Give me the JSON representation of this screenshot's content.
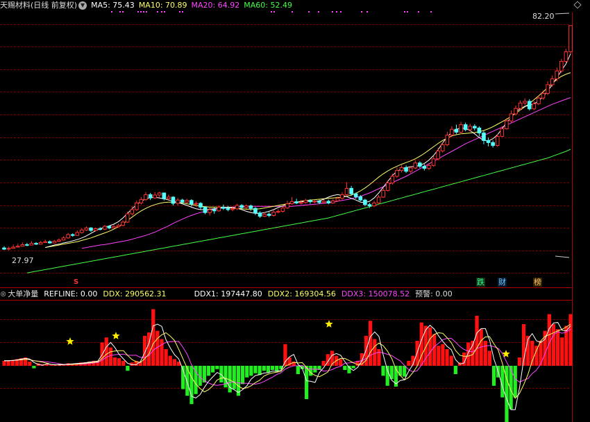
{
  "header": {
    "title": "天赐材料(日线 前复权)",
    "dropdown_icon": "chevron-down-icon",
    "ma5": {
      "label": "MA5: 75.43",
      "color": "#ffffff"
    },
    "ma10": {
      "label": "MA10: 70.89",
      "color": "#ffff66"
    },
    "ma20": {
      "label": "MA20: 64.92",
      "color": "#ff44ff"
    },
    "ma60": {
      "label": "MA60: 52.49",
      "color": "#44ff44"
    }
  },
  "price_labels": {
    "high": "82.20",
    "low": "27.97"
  },
  "signals": {
    "s_marker": "S",
    "badges": [
      {
        "text": "跌",
        "color": "#33ff99",
        "bg": "#113311"
      },
      {
        "text": "财",
        "color": "#66ccff",
        "bg": "#0a1a33"
      },
      {
        "text": "榜",
        "color": "#ffcc66",
        "bg": "#332200"
      }
    ]
  },
  "indicator": {
    "name": "大单净量",
    "refline": {
      "label": "REFLINE: 0.00",
      "color": "#ffffff"
    },
    "ddx": {
      "label": "DDX: 290562.31",
      "color": "#ffff66"
    },
    "ddx1": {
      "label": "DDX1: 197447.80",
      "color": "#ffffff"
    },
    "ddx2": {
      "label": "DDX2: 169304.56",
      "color": "#ffff66"
    },
    "ddx3": {
      "label": "DDX3: 150078.52",
      "color": "#ff44ff"
    },
    "alert": {
      "label": "预警: 0.00",
      "color": "#dddddd"
    }
  },
  "colors": {
    "up": "#ff3333",
    "down": "#54ffff",
    "bar_pos": "#ff1111",
    "bar_neg": "#22ee22",
    "star": "#ffee00",
    "ma5": "#ffffff",
    "ma10": "#ffff66",
    "ma20": "#ff44ff",
    "ma60": "#44ff44"
  },
  "chart_data": {
    "type": "candlestick",
    "ylim": [
      27.97,
      82.2
    ],
    "candles": [
      [
        28.8,
        28.5,
        29.2,
        28.3
      ],
      [
        28.5,
        28.7,
        29.1,
        28.2
      ],
      [
        28.7,
        29.0,
        29.6,
        28.6
      ],
      [
        29.0,
        29.2,
        29.8,
        28.9
      ],
      [
        29.2,
        29.6,
        30.1,
        29.1
      ],
      [
        29.6,
        29.5,
        30.0,
        29.2
      ],
      [
        29.5,
        29.9,
        30.4,
        29.4
      ],
      [
        29.9,
        29.7,
        30.2,
        29.5
      ],
      [
        29.7,
        30.1,
        30.5,
        29.6
      ],
      [
        30.1,
        30.3,
        30.8,
        30.0
      ],
      [
        30.3,
        30.0,
        30.6,
        29.8
      ],
      [
        30.0,
        30.4,
        30.7,
        29.9
      ],
      [
        30.4,
        30.7,
        31.1,
        30.2
      ],
      [
        30.7,
        31.2,
        31.6,
        30.6
      ],
      [
        31.2,
        32.0,
        32.4,
        31.0
      ],
      [
        32.0,
        31.8,
        32.3,
        31.5
      ],
      [
        31.8,
        32.5,
        33.0,
        31.7
      ],
      [
        32.5,
        33.1,
        33.5,
        32.2
      ],
      [
        33.1,
        33.6,
        34.0,
        32.9
      ],
      [
        33.6,
        33.0,
        33.8,
        32.6
      ],
      [
        33.0,
        33.4,
        33.7,
        32.7
      ],
      [
        33.4,
        33.3,
        33.8,
        33.0
      ],
      [
        33.3,
        34.0,
        34.3,
        33.1
      ],
      [
        34.0,
        33.6,
        34.2,
        33.3
      ],
      [
        33.6,
        33.9,
        34.4,
        33.5
      ],
      [
        33.9,
        34.2,
        34.6,
        33.7
      ],
      [
        34.2,
        35.0,
        35.4,
        34.0
      ],
      [
        35.0,
        37.0,
        37.5,
        34.8
      ],
      [
        37.0,
        38.0,
        38.8,
        36.6
      ],
      [
        38.0,
        39.6,
        40.2,
        37.7
      ],
      [
        39.6,
        40.4,
        41.0,
        39.2
      ],
      [
        40.4,
        41.6,
        42.2,
        40.1
      ],
      [
        41.6,
        40.8,
        42.0,
        40.3
      ],
      [
        40.8,
        41.5,
        42.2,
        40.6
      ],
      [
        41.5,
        42.0,
        42.3,
        40.9
      ],
      [
        42.0,
        40.6,
        42.1,
        40.2
      ],
      [
        40.6,
        41.0,
        41.6,
        40.3
      ],
      [
        41.0,
        39.5,
        41.2,
        39.0
      ],
      [
        39.5,
        40.3,
        40.8,
        39.0
      ],
      [
        40.3,
        39.8,
        40.6,
        39.4
      ],
      [
        39.8,
        40.2,
        40.6,
        39.5
      ],
      [
        40.2,
        39.3,
        40.5,
        38.8
      ],
      [
        39.3,
        39.5,
        40.0,
        38.7
      ],
      [
        39.5,
        38.6,
        39.8,
        38.1
      ],
      [
        38.6,
        37.3,
        38.8,
        36.9
      ],
      [
        37.3,
        38.0,
        38.6,
        36.6
      ],
      [
        38.0,
        37.7,
        38.5,
        37.0
      ],
      [
        37.7,
        38.6,
        39.0,
        37.5
      ],
      [
        38.6,
        38.3,
        39.2,
        37.9
      ],
      [
        38.3,
        38.0,
        38.9,
        37.6
      ],
      [
        38.0,
        38.2,
        38.8,
        37.6
      ],
      [
        38.2,
        39.0,
        39.4,
        37.9
      ],
      [
        39.0,
        38.5,
        39.3,
        38.1
      ],
      [
        38.5,
        38.9,
        39.3,
        38.2
      ],
      [
        38.9,
        38.3,
        39.2,
        37.7
      ],
      [
        38.3,
        37.2,
        38.6,
        36.7
      ],
      [
        37.2,
        36.4,
        37.6,
        36.0
      ],
      [
        36.4,
        36.9,
        37.4,
        36.2
      ],
      [
        36.9,
        36.6,
        37.4,
        36.2
      ],
      [
        36.6,
        37.4,
        37.8,
        36.3
      ],
      [
        37.4,
        37.6,
        38.1,
        37.1
      ],
      [
        37.6,
        38.4,
        38.9,
        37.3
      ],
      [
        38.4,
        39.4,
        40.1,
        38.2
      ],
      [
        39.4,
        39.9,
        41.0,
        39.2
      ],
      [
        39.9,
        39.6,
        40.6,
        39.3
      ],
      [
        39.6,
        39.7,
        40.3,
        39.2
      ],
      [
        39.7,
        40.2,
        40.6,
        39.4
      ],
      [
        40.2,
        39.9,
        40.5,
        39.4
      ],
      [
        39.9,
        40.0,
        40.4,
        39.5
      ],
      [
        40.0,
        39.7,
        40.4,
        39.3
      ],
      [
        39.7,
        40.0,
        40.4,
        39.4
      ],
      [
        40.0,
        39.6,
        40.4,
        39.3
      ],
      [
        39.6,
        40.1,
        40.5,
        39.4
      ],
      [
        40.1,
        40.7,
        41.1,
        39.9
      ],
      [
        40.7,
        41.6,
        42.2,
        40.4
      ],
      [
        41.6,
        43.1,
        44.6,
        41.2
      ],
      [
        43.1,
        41.8,
        43.7,
        41.3
      ],
      [
        41.8,
        41.1,
        42.1,
        40.6
      ],
      [
        41.1,
        40.3,
        41.5,
        40.0
      ],
      [
        40.3,
        39.2,
        40.6,
        38.8
      ],
      [
        39.2,
        38.9,
        39.6,
        38.4
      ],
      [
        38.9,
        39.6,
        40.1,
        38.6
      ],
      [
        39.6,
        41.0,
        41.5,
        39.3
      ],
      [
        41.0,
        42.6,
        43.2,
        40.8
      ],
      [
        42.6,
        44.4,
        45.0,
        42.3
      ],
      [
        44.4,
        46.0,
        46.6,
        44.0
      ],
      [
        46.0,
        47.4,
        48.1,
        45.6
      ],
      [
        47.4,
        48.1,
        48.7,
        46.9
      ],
      [
        48.1,
        47.2,
        48.6,
        46.8
      ],
      [
        47.2,
        48.0,
        48.5,
        46.8
      ],
      [
        48.0,
        49.2,
        49.8,
        47.7
      ],
      [
        49.2,
        48.4,
        49.6,
        48.0
      ],
      [
        48.4,
        47.9,
        48.9,
        47.4
      ],
      [
        47.9,
        48.6,
        49.1,
        47.5
      ],
      [
        48.6,
        50.2,
        50.9,
        48.3
      ],
      [
        50.2,
        52.1,
        52.8,
        49.8
      ],
      [
        52.1,
        53.6,
        54.2,
        51.7
      ],
      [
        53.6,
        55.9,
        56.7,
        53.2
      ],
      [
        55.9,
        57.3,
        58.0,
        55.4
      ],
      [
        57.3,
        56.6,
        58.4,
        56.2
      ],
      [
        56.6,
        58.4,
        59.1,
        56.1
      ],
      [
        58.4,
        57.2,
        58.9,
        56.8
      ],
      [
        57.2,
        58.0,
        58.6,
        56.7
      ],
      [
        58.0,
        57.6,
        58.5,
        57.0
      ],
      [
        57.6,
        56.4,
        58.0,
        55.6
      ],
      [
        56.4,
        54.6,
        56.9,
        53.7
      ],
      [
        54.6,
        54.1,
        55.3,
        53.2
      ],
      [
        54.1,
        53.4,
        54.6,
        52.9
      ],
      [
        53.4,
        55.6,
        56.1,
        53.1
      ],
      [
        55.6,
        57.4,
        58.0,
        55.4
      ],
      [
        57.4,
        59.3,
        60.0,
        57.2
      ],
      [
        59.3,
        61.0,
        61.8,
        58.9
      ],
      [
        61.0,
        62.3,
        63.0,
        60.6
      ],
      [
        62.3,
        63.6,
        64.2,
        61.8
      ],
      [
        63.6,
        64.0,
        64.7,
        62.9
      ],
      [
        64.0,
        62.2,
        64.5,
        61.8
      ],
      [
        62.2,
        63.4,
        64.0,
        61.9
      ],
      [
        63.4,
        64.8,
        65.5,
        63.1
      ],
      [
        64.8,
        65.9,
        66.6,
        64.4
      ],
      [
        65.9,
        68.0,
        68.8,
        65.5
      ],
      [
        68.0,
        69.4,
        70.2,
        67.5
      ],
      [
        69.4,
        71.3,
        72.1,
        68.8
      ],
      [
        71.3,
        73.6,
        74.2,
        70.8
      ],
      [
        73.6,
        75.9,
        76.6,
        73.2
      ],
      [
        75.9,
        82.2,
        82.2,
        75.4
      ]
    ],
    "ma5": [
      28.9,
      29.2,
      29.5,
      29.7,
      30.0,
      30.2,
      30.5,
      30.8,
      31.2,
      31.7,
      32.3,
      32.9,
      33.4,
      33.8,
      34.1,
      34.5,
      35.1,
      36.0,
      37.1,
      38.2,
      39.2,
      40.0,
      40.6,
      40.9,
      41.0,
      40.8,
      40.6,
      40.3,
      40.0,
      39.7,
      39.4,
      39.0,
      38.6,
      38.2,
      38.0,
      38.0,
      38.1,
      38.2,
      38.4,
      38.5,
      38.6,
      38.5,
      38.3,
      38.0,
      37.6,
      37.3,
      37.1,
      37.1,
      37.3,
      37.6,
      38.0,
      38.5,
      38.9,
      39.3,
      39.6,
      39.8,
      39.9,
      40.0,
      40.0,
      40.0,
      40.1,
      40.5,
      41.0,
      41.4,
      41.6,
      41.4,
      41.1,
      40.7,
      40.3,
      39.8,
      39.7,
      40.0,
      40.8,
      42.0,
      43.4,
      44.8,
      46.2,
      47.2,
      47.8,
      48.1,
      48.3,
      48.4,
      48.6,
      49.1,
      49.9,
      51.0,
      52.4,
      54.0,
      55.5,
      56.6,
      57.3,
      57.6,
      57.5,
      57.0,
      56.2,
      55.3,
      54.6,
      54.5,
      55.0,
      56.0,
      57.4,
      58.9,
      60.2,
      61.4,
      62.3,
      62.8,
      63.0,
      63.4,
      64.1,
      65.1,
      66.5,
      68.0,
      69.7,
      71.4,
      73.0,
      75.4
    ],
    "ma10": [
      28.9,
      29.1,
      29.3,
      29.5,
      29.7,
      29.9,
      30.1,
      30.3,
      30.6,
      30.9,
      31.2,
      31.6,
      32.0,
      32.4,
      32.8,
      33.3,
      33.9,
      34.6,
      35.4,
      36.2,
      37.0,
      37.7,
      38.3,
      38.8,
      39.2,
      39.5,
      39.7,
      39.8,
      39.8,
      39.7,
      39.6,
      39.4,
      39.2,
      39.0,
      38.8,
      38.7,
      38.6,
      38.6,
      38.6,
      38.6,
      38.5,
      38.4,
      38.3,
      38.2,
      38.1,
      38.1,
      38.1,
      38.2,
      38.4,
      38.6,
      38.8,
      39.0,
      39.2,
      39.4,
      39.6,
      39.8,
      40.0,
      40.2,
      40.3,
      40.4,
      40.5,
      40.6,
      40.7,
      40.8,
      40.9,
      41.0,
      41.2,
      41.5,
      41.9,
      42.5,
      43.2,
      44.0,
      44.9,
      45.8,
      46.6,
      47.3,
      47.9,
      48.4,
      48.9,
      49.3,
      49.7,
      50.2,
      50.8,
      51.5,
      52.3,
      53.1,
      53.9,
      54.6,
      55.2,
      55.7,
      56.0,
      56.2,
      56.3,
      56.4,
      56.5,
      56.7,
      57.0,
      57.4,
      57.9,
      58.5,
      59.1,
      59.7,
      60.4,
      61.1,
      61.9,
      62.7,
      63.5,
      64.4,
      65.3,
      66.3,
      67.3,
      68.3,
      69.3,
      70.0,
      70.5,
      70.9
    ],
    "ma20": [
      28.7,
      28.9,
      29.1,
      29.3,
      29.5,
      29.6,
      29.8,
      30.0,
      30.2,
      30.4,
      30.6,
      30.9,
      31.2,
      31.5,
      31.8,
      32.2,
      32.6,
      33.1,
      33.6,
      34.1,
      34.7,
      35.2,
      35.7,
      36.2,
      36.6,
      37.0,
      37.3,
      37.6,
      37.9,
      38.1,
      38.3,
      38.4,
      38.5,
      38.6,
      38.7,
      38.7,
      38.8,
      38.8,
      38.8,
      38.8,
      38.8,
      38.8,
      38.8,
      38.8,
      38.8,
      38.8,
      38.8,
      38.9,
      39.0,
      39.1,
      39.2,
      39.3,
      39.4,
      39.5,
      39.6,
      39.8,
      40.0,
      40.2,
      40.4,
      40.6,
      40.9,
      41.2,
      41.6,
      42.0,
      42.5,
      43.0,
      43.5,
      44.0,
      44.5,
      45.0,
      45.5,
      46.0,
      46.6,
      47.2,
      47.8,
      48.4,
      49.0,
      49.6,
      50.2,
      50.8,
      51.4,
      52.0,
      52.6,
      53.2,
      53.8,
      54.3,
      54.8,
      55.3,
      55.8,
      56.3,
      56.8,
      57.3,
      57.8,
      58.3,
      58.8,
      59.3,
      59.8,
      60.3,
      60.8,
      61.3,
      61.8,
      62.3,
      62.8,
      63.3,
      63.7,
      64.1,
      64.5,
      64.9
    ],
    "ma60": [
      22.8,
      23.0,
      23.2,
      23.4,
      23.6,
      23.8,
      24.0,
      24.2,
      24.4,
      24.6,
      24.8,
      25.0,
      25.2,
      25.4,
      25.6,
      25.8,
      26.0,
      26.2,
      26.4,
      26.6,
      26.8,
      27.0,
      27.2,
      27.4,
      27.6,
      27.8,
      28.0,
      28.2,
      28.4,
      28.6,
      28.8,
      29.0,
      29.2,
      29.4,
      29.6,
      29.8,
      30.0,
      30.2,
      30.4,
      30.6,
      30.8,
      31.0,
      31.2,
      31.4,
      31.6,
      31.8,
      32.0,
      32.2,
      32.4,
      32.6,
      32.8,
      33.0,
      33.2,
      33.4,
      33.6,
      33.8,
      34.0,
      34.2,
      34.4,
      34.6,
      34.8,
      35.0,
      35.2,
      35.4,
      35.6,
      35.8,
      36.0,
      36.3,
      36.6,
      36.9,
      37.2,
      37.5,
      37.8,
      38.1,
      38.4,
      38.7,
      39.0,
      39.3,
      39.6,
      39.9,
      40.2,
      40.5,
      40.8,
      41.1,
      41.4,
      41.7,
      42.0,
      42.3,
      42.6,
      42.9,
      43.2,
      43.5,
      43.8,
      44.1,
      44.4,
      44.7,
      45.0,
      45.3,
      45.6,
      45.9,
      46.2,
      46.5,
      46.8,
      47.1,
      47.4,
      47.7,
      48.0,
      48.3,
      48.6,
      48.9,
      49.2,
      49.5,
      49.8,
      50.1,
      50.4,
      50.8,
      51.2,
      51.6,
      52.0,
      52.49
    ],
    "indicator_bars": [
      0.6,
      0.6,
      0.7,
      0.8,
      0.9,
      1.0,
      0.5,
      -0.3,
      0.3,
      0.2,
      0.2,
      0.1,
      0.1,
      0.1,
      0.2,
      0.3,
      0.2,
      0.3,
      0.4,
      0.4,
      0.5,
      0.6,
      0.6,
      2.8,
      3.4,
      2.2,
      1.0,
      0.9,
      0.6,
      -0.6,
      0.4,
      0.6,
      0.5,
      3.6,
      4.0,
      6.8,
      4.2,
      3.2,
      2.0,
      1.2,
      0.8,
      0.5,
      -2.8,
      -3.6,
      -4.6,
      -3.4,
      -2.4,
      -2.0,
      -1.2,
      -0.8,
      -0.4,
      -2.0,
      -2.6,
      -3.2,
      -2.8,
      -3.6,
      -2.2,
      -1.4,
      -1.2,
      -0.9,
      -1.1,
      -0.6,
      -0.8,
      -0.5,
      -0.7,
      -0.4,
      2.6,
      1.0,
      0.5,
      -1.0,
      -0.4,
      -4.0,
      -1.2,
      -0.8,
      -0.5,
      0.6,
      1.4,
      1.8,
      1.2,
      0.8,
      -0.5,
      -0.9,
      -0.3,
      0.6,
      1.5,
      3.6,
      5.4,
      3.2,
      2.0,
      -1.2,
      -2.4,
      -1.6,
      -2.5,
      -1.2,
      -1.3,
      0.6,
      1.2,
      3.0,
      5.2,
      4.8,
      4.6,
      3.8,
      2.4,
      2.6,
      2.0,
      1.2,
      -1.0,
      0.4,
      1.6,
      2.8,
      3.0,
      6.0,
      4.4,
      3.0,
      1.8,
      -2.4,
      -1.4,
      -3.8,
      -6.8,
      -5.2,
      -3.8,
      1.0,
      5.0,
      3.6,
      3.0,
      2.4,
      3.0,
      4.2,
      6.2,
      5.0,
      4.4,
      3.4,
      4.8,
      6.2
    ]
  }
}
